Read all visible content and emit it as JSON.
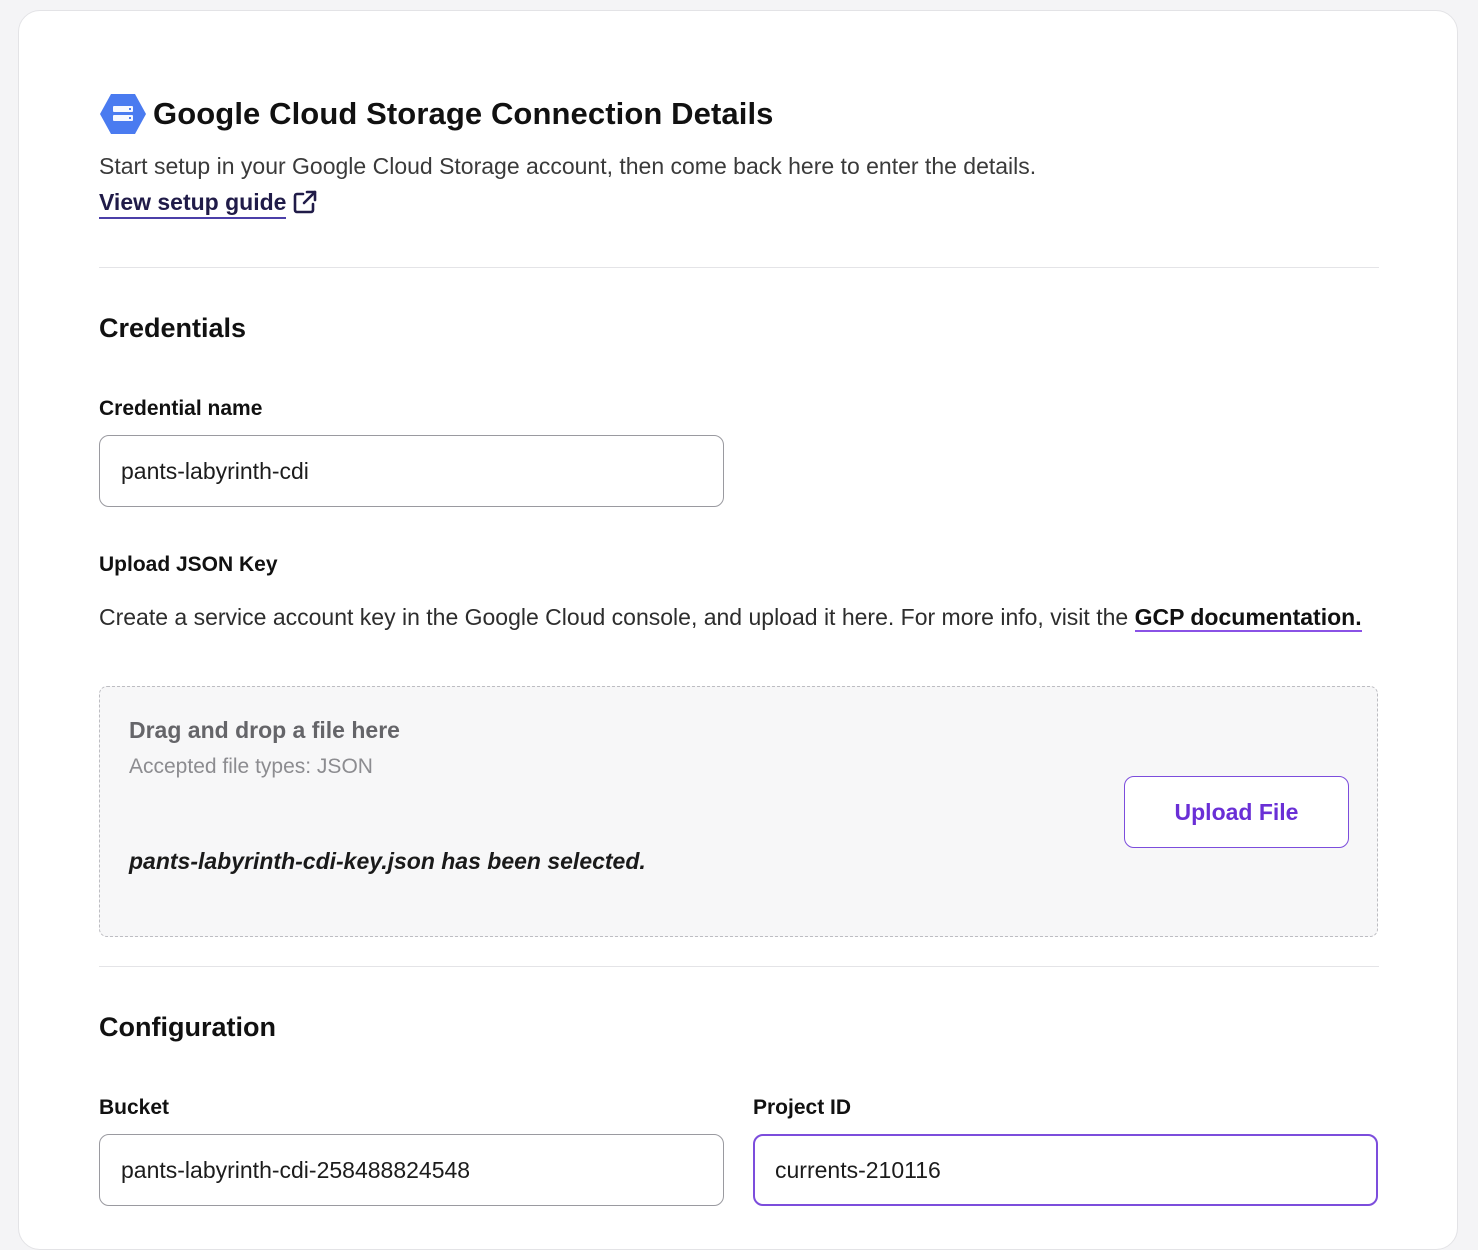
{
  "header": {
    "title": "Google Cloud Storage Connection Details",
    "intro": "Start setup in your Google Cloud Storage account, then come back here to enter the details.",
    "guide_link": "View setup guide",
    "icon": "google-cloud-storage-icon",
    "link_icon": "external-link-icon"
  },
  "credentials": {
    "section_title": "Credentials",
    "credential_name_label": "Credential name",
    "credential_name_value": "pants-labyrinth-cdi",
    "upload_label": "Upload JSON Key",
    "upload_desc": "Create a service account key in the Google Cloud console, and upload it here. For more info, visit the ",
    "gcp_link": "GCP documentation.",
    "dropzone": {
      "title": "Drag and drop a file here",
      "accepted": "Accepted file types: JSON",
      "selected": "pants-labyrinth-cdi-key.json has been selected.",
      "button": "Upload File"
    }
  },
  "configuration": {
    "section_title": "Configuration",
    "bucket_label": "Bucket",
    "bucket_value": "pants-labyrinth-cdi-258488824548",
    "project_label": "Project ID",
    "project_value": "currents-210116"
  },
  "colors": {
    "accent": "#7c4ddc",
    "link_underline": "#4b3fa8",
    "gcs_blue": "#4a7bf0"
  }
}
